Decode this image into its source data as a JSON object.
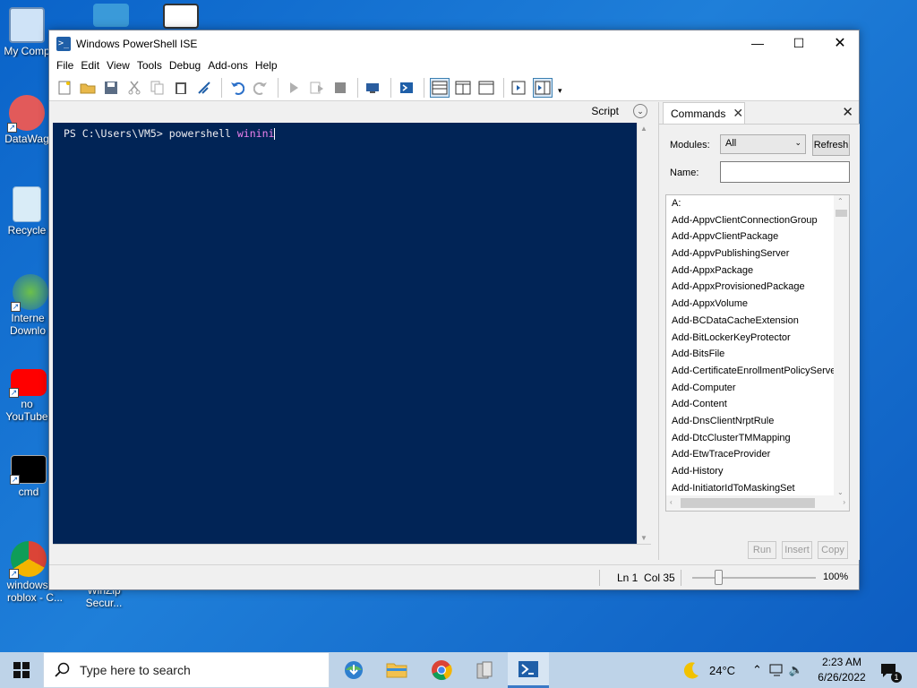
{
  "desktop": {
    "icons": [
      {
        "label": "My Comp"
      },
      {
        "label": "DataWag"
      },
      {
        "label": "Recycle"
      },
      {
        "label": "Interne\nDownlo"
      },
      {
        "label": "no\nYouTube"
      },
      {
        "label": "cmd"
      },
      {
        "label": "windows 10\nroblox - C..."
      },
      {
        "label": "WinZip\nSecur..."
      }
    ]
  },
  "window": {
    "title": "Windows PowerShell ISE",
    "menu": [
      "File",
      "Edit",
      "View",
      "Tools",
      "Debug",
      "Add-ons",
      "Help"
    ]
  },
  "console": {
    "header_label": "Script",
    "prompt": "PS C:\\Users\\VM5> ",
    "command": "powershell",
    "argument": " winini"
  },
  "commands_pane": {
    "tab_label": "Commands",
    "modules_label": "Modules:",
    "modules_value": "All",
    "refresh_label": "Refresh",
    "name_label": "Name:",
    "name_value": "",
    "items": [
      "A:",
      "Add-AppvClientConnectionGroup",
      "Add-AppvClientPackage",
      "Add-AppvPublishingServer",
      "Add-AppxPackage",
      "Add-AppxProvisionedPackage",
      "Add-AppxVolume",
      "Add-BCDataCacheExtension",
      "Add-BitLockerKeyProtector",
      "Add-BitsFile",
      "Add-CertificateEnrollmentPolicyServer",
      "Add-Computer",
      "Add-Content",
      "Add-DnsClientNrptRule",
      "Add-DtcClusterTMMapping",
      "Add-EtwTraceProvider",
      "Add-History",
      "Add-InitiatorIdToMaskingSet"
    ],
    "run_label": "Run",
    "insert_label": "Insert",
    "copy_label": "Copy"
  },
  "statusbar": {
    "position": "Ln 1  Col 35",
    "zoom": "100%"
  },
  "taskbar": {
    "search_placeholder": "Type here to search",
    "weather": "24°C",
    "time": "2:23 AM",
    "date": "6/26/2022",
    "notification_count": "1"
  },
  "colors": {
    "console_bg": "#012456",
    "accent": "#0078d7"
  }
}
